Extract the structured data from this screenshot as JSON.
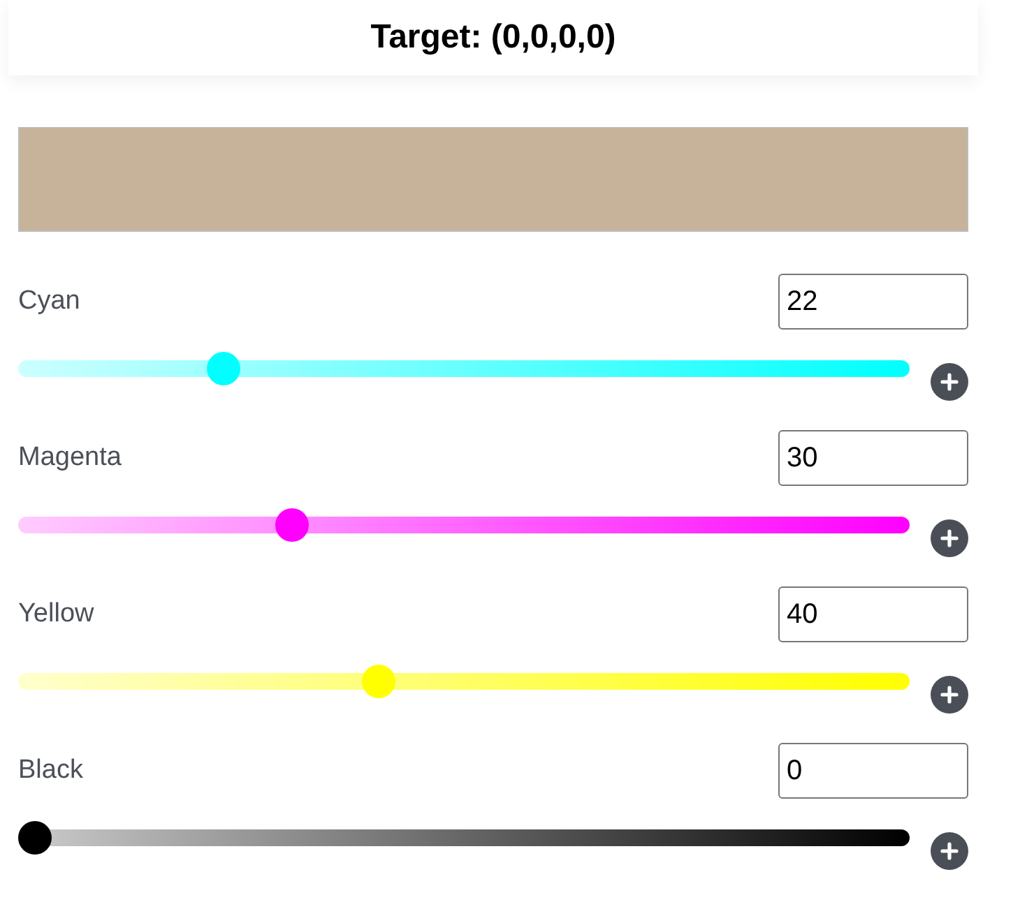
{
  "header": {
    "title": "Target: (0,0,0,0)"
  },
  "preview": {
    "color": "#c6b39a"
  },
  "channels": [
    {
      "name": "Cyan",
      "value": "22",
      "level": 0.22,
      "color": "#00ffff"
    },
    {
      "name": "Magenta",
      "value": "30",
      "level": 0.3,
      "color": "#ff00ff"
    },
    {
      "name": "Yellow",
      "value": "40",
      "level": 0.4,
      "color": "#ffff00"
    },
    {
      "name": "Black",
      "value": "0",
      "level": 0,
      "color": "#000000"
    }
  ]
}
